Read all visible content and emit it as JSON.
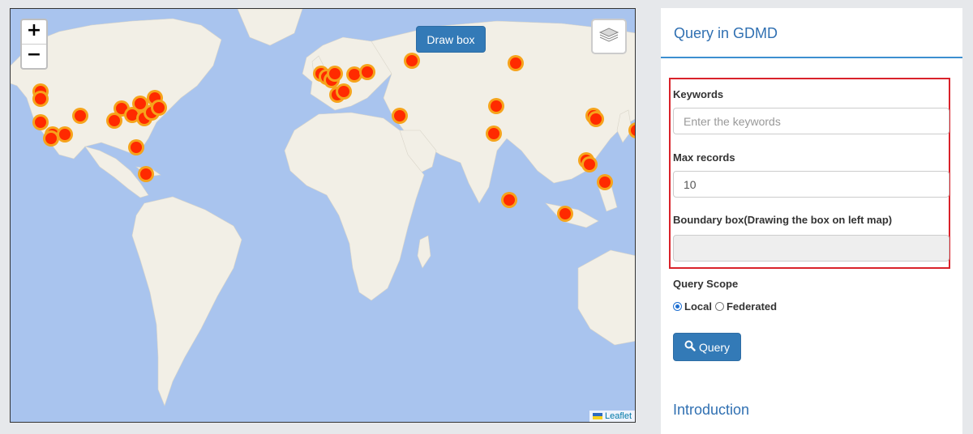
{
  "map": {
    "zoom_in": "+",
    "zoom_out": "−",
    "draw_box_label": "Draw box",
    "layers_icon": "layers-icon",
    "attribution": "Leaflet",
    "marker_count": 52
  },
  "panel": {
    "title": "Query in GDMD",
    "keywords_label": "Keywords",
    "keywords_placeholder": "Enter the keywords",
    "keywords_value": "",
    "max_records_label": "Max records",
    "max_records_value": "10",
    "bbox_label": "Boundary box(Drawing the box on left map)",
    "bbox_value": "",
    "scope_label": "Query Scope",
    "scope_options": [
      "Local",
      "Federated"
    ],
    "scope_selected": "Local",
    "query_button": "Query",
    "introduction": "Introduction"
  },
  "colors": {
    "accent": "#337ab7",
    "title_blue": "#3070b2",
    "highlight_border": "#d9222a",
    "marker_fill": "#ff2a00",
    "marker_ring": "#f6a31b"
  }
}
